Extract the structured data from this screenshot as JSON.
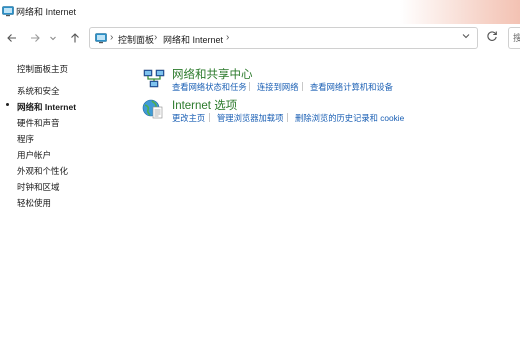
{
  "window": {
    "title": "网络和 Internet"
  },
  "nav": {
    "back_icon": "arrow-left-icon",
    "forward_icon": "arrow-right-icon",
    "recent_icon": "chevron-down-icon",
    "up_icon": "arrow-up-icon",
    "breadcrumb": [
      "控制面板",
      "网络和 Internet"
    ],
    "refresh_icon": "refresh-icon",
    "search_placeholder": "搜"
  },
  "sidebar": {
    "items": [
      {
        "label": "控制面板主页",
        "active": false
      },
      {
        "label": "系统和安全",
        "active": false
      },
      {
        "label": "网络和 Internet",
        "active": true
      },
      {
        "label": "硬件和声音",
        "active": false
      },
      {
        "label": "程序",
        "active": false
      },
      {
        "label": "用户帐户",
        "active": false
      },
      {
        "label": "外观和个性化",
        "active": false
      },
      {
        "label": "时钟和区域",
        "active": false
      },
      {
        "label": "轻松使用",
        "active": false
      }
    ]
  },
  "categories": [
    {
      "title": "网络和共享中心",
      "icon": "network-sharing-center-icon",
      "links": [
        "查看网络状态和任务",
        "连接到网络",
        "查看网络计算机和设备"
      ]
    },
    {
      "title": "Internet 选项",
      "icon": "internet-options-globe-icon",
      "links": [
        "更改主页",
        "管理浏览器加载项",
        "删除浏览的历史记录和 cookie"
      ]
    }
  ],
  "colors": {
    "category_title": "#2b7a2b",
    "link": "#1a5fb4"
  }
}
